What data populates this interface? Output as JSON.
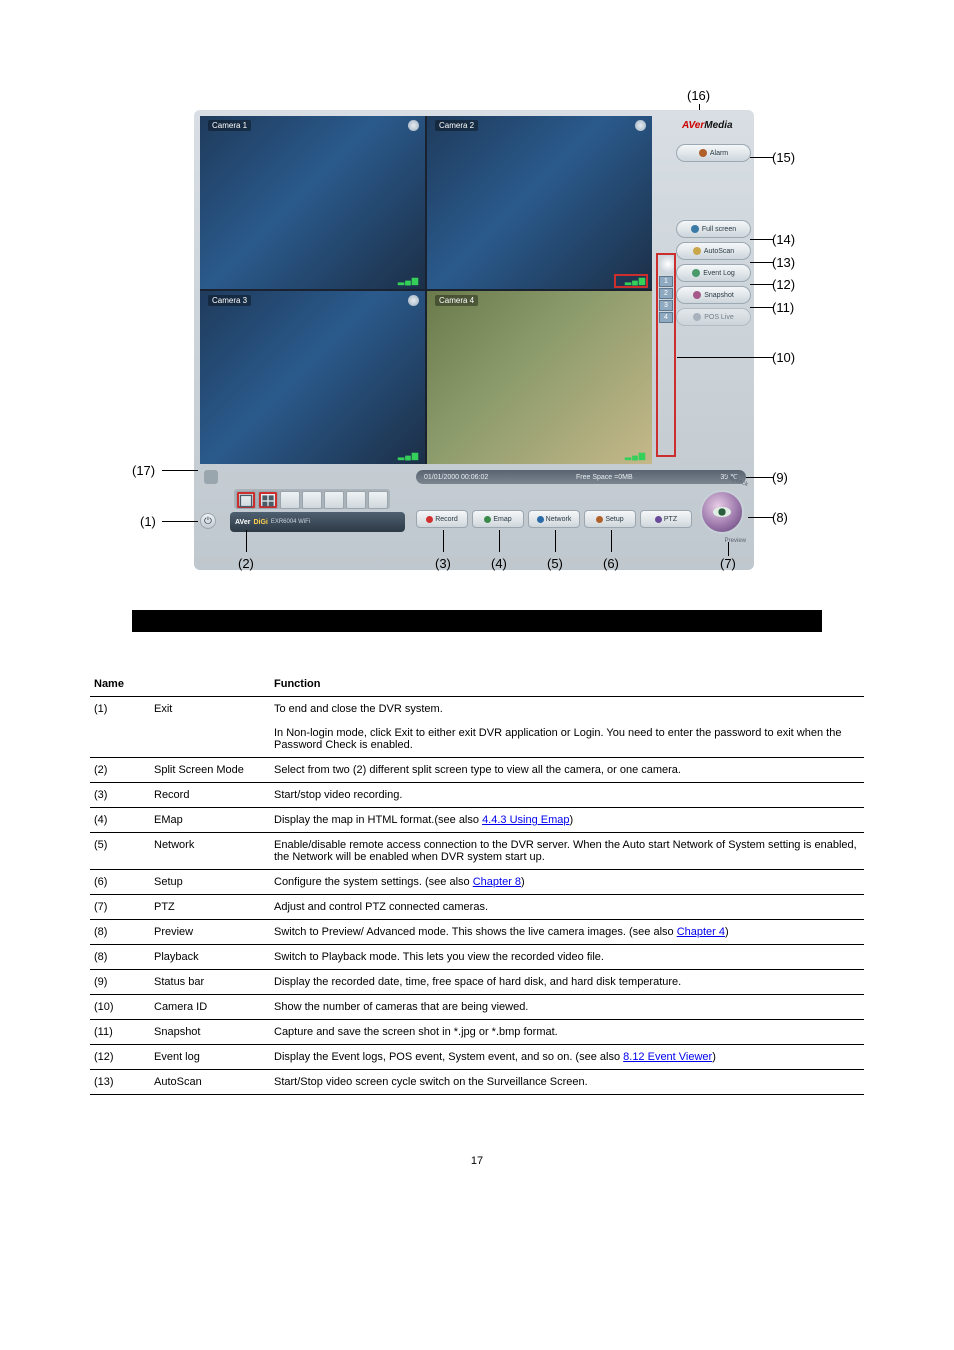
{
  "illustration": {
    "brand_a": "AVer",
    "brand_b": "Media",
    "cameras": [
      "Camera 1",
      "Camera 2",
      "Camera 3",
      "Camera 4"
    ],
    "signal_label": "▂▄▆",
    "ch_nums": [
      "1",
      "2",
      "3",
      "4"
    ],
    "side_buttons": {
      "alarm": "Alarm",
      "fullscreen": "Full screen",
      "autoscan": "AutoScan",
      "eventlog": "Event Log",
      "snapshot": "Snapshot",
      "posviewer": "POS Live"
    },
    "status": {
      "datetime": "01/01/2000  00:06:02",
      "space": "Free Space  =0MB",
      "temp": "39  ℃"
    },
    "bottom_tabs": {
      "record": "Record",
      "emap": "Emap",
      "network": "Network",
      "setup": "Setup",
      "ptz": "PTZ"
    },
    "model": {
      "a": "AVer",
      "b": "DiGi",
      "c": "EXR6004 WiFi"
    },
    "eye_caption": "Preview",
    "eye_top": "Playback",
    "callouts": {
      "c1": "(1)",
      "c2": "(2)",
      "c3": "(3)",
      "c4": "(4)",
      "c5": "(5)",
      "c6": "(6)",
      "c7": "(7)",
      "c8": "(8)",
      "c9": "(9)",
      "c10": "(10)",
      "c11": "(11)",
      "c12": "(12)",
      "c13": "(13)",
      "c14": "(14)",
      "c15": "(15)",
      "c16": "(16)",
      "c17": "(17)"
    }
  },
  "table": {
    "headers": {
      "name": "Name",
      "func": "Function"
    },
    "rows": [
      {
        "no": "(1)",
        "name": "Exit",
        "func": "To end and close the DVR system.",
        "cont": "In Non-login mode, click Exit to either exit DVR application or Login. You need to enter the password to exit when the Password Check is enabled."
      },
      {
        "no": "(2)",
        "name": "Split Screen Mode",
        "func": "Select from two (2) different split screen type to view all the camera, or one camera."
      },
      {
        "no": "(3)",
        "name": "Record",
        "func": "Start/stop video recording."
      },
      {
        "no": "(4)",
        "name": "EMap",
        "func": "Display the map in HTML format.(see also ",
        "link": "4.4.3 Using Emap",
        "after": ") "
      },
      {
        "no": "(5)",
        "name": "Network",
        "func": "Enable/disable remote access connection to the DVR server. When the Auto start Network of System setting is enabled, the Network will be enabled when DVR system start up."
      },
      {
        "no": "(6)",
        "name": "Setup",
        "func": "Configure the system settings. (see also ",
        "link": "Chapter 8",
        "after": ")"
      },
      {
        "no": "(7)",
        "name": "PTZ",
        "func": "Adjust and control PTZ connected cameras."
      },
      {
        "no": "(8)",
        "name": "Preview",
        "func": "Switch to Preview/ Advanced mode. This shows the live camera images. (see also ",
        "link": "Chapter 4",
        "after": ")"
      },
      {
        "no": "(8)",
        "name": "Playback",
        "func": "Switch to Playback mode. This lets you view the recorded video file."
      },
      {
        "no": "(9)",
        "name": "Status bar",
        "func": "Display the recorded date, time, free space of hard disk, and hard disk temperature."
      },
      {
        "no": "(10)",
        "name": "Camera ID",
        "func": "Show the number of cameras that are being viewed."
      },
      {
        "no": "(11)",
        "name": "Snapshot",
        "func": "Capture and save the screen shot in *.jpg or *.bmp format."
      },
      {
        "no": "(12)",
        "name": "Event log",
        "func": "Display the Event logs, POS event, System event, and so on. (see also ",
        "link": "8.12 Event Viewer",
        "after": ")"
      },
      {
        "no": "(13)",
        "name": "AutoScan",
        "func": "Start/Stop video screen cycle switch on the Surveillance Screen."
      }
    ]
  },
  "page_number": "17"
}
